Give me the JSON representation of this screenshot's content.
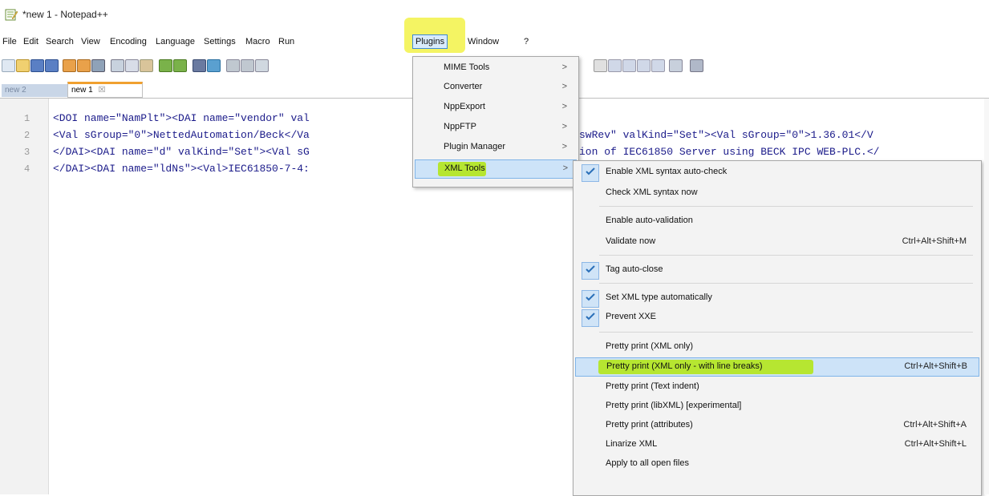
{
  "window": {
    "title": "*new 1 - Notepad++"
  },
  "menubar": {
    "items": [
      "File",
      "Edit",
      "Search",
      "View",
      "Encoding",
      "Language",
      "Settings",
      "Macro",
      "Run",
      "Plugins",
      "Window",
      "?"
    ]
  },
  "tabs": [
    {
      "label": "new 2"
    },
    {
      "label": "new 1"
    }
  ],
  "editor": {
    "lines": [
      {
        "no": "1",
        "text": "<DOI name=\"NamPlt\"><DAI name=\"vendor\" val"
      },
      {
        "no": "2",
        "text": "<Val sGroup=\"0\">NettedAutomation/Beck</Va"
      },
      {
        "no": "3",
        "text": "</DAI><DAI name=\"d\" valKind=\"Set\"><Val sG"
      },
      {
        "no": "4",
        "text": "</DAI><DAI name=\"ldNs\"><Val>IEC61850-7-4:"
      }
    ],
    "right_fragments": [
      "swRev\" valKind=\"Set\"><Val sGroup=\"0\">1.36.01</V",
      "ion of IEC61850 Server using BECK IPC WEB-PLC.</"
    ]
  },
  "plugins_menu": {
    "items": [
      {
        "label": "MIME Tools",
        "arrow": ">"
      },
      {
        "label": "Converter",
        "arrow": ">"
      },
      {
        "label": "NppExport",
        "arrow": ">"
      },
      {
        "label": "NppFTP",
        "arrow": ">"
      },
      {
        "label": "Plugin Manager",
        "arrow": ">"
      },
      {
        "label": "XML Tools",
        "arrow": ">"
      }
    ]
  },
  "xml_tools_menu": {
    "items": [
      {
        "label": "Enable XML syntax auto-check",
        "shortcut": "",
        "checked": true
      },
      {
        "label": "Check XML syntax now",
        "shortcut": "",
        "checked": false
      },
      {
        "label": "Enable auto-validation",
        "shortcut": "",
        "checked": false
      },
      {
        "label": "Validate now",
        "shortcut": "Ctrl+Alt+Shift+M",
        "checked": false
      },
      {
        "label": "Tag auto-close",
        "shortcut": "",
        "checked": true
      },
      {
        "label": "Set XML type automatically",
        "shortcut": "",
        "checked": true
      },
      {
        "label": "Prevent XXE",
        "shortcut": "",
        "checked": true
      },
      {
        "label": "Pretty print (XML only)",
        "shortcut": "",
        "checked": false
      },
      {
        "label": "Pretty print (XML only - with line breaks)",
        "shortcut": "Ctrl+Alt+Shift+B",
        "checked": false
      },
      {
        "label": "Pretty print (Text indent)",
        "shortcut": "",
        "checked": false
      },
      {
        "label": "Pretty print (libXML) [experimental]",
        "shortcut": "",
        "checked": false
      },
      {
        "label": "Pretty print (attributes)",
        "shortcut": "Ctrl+Alt+Shift+A",
        "checked": false
      },
      {
        "label": "Linarize XML",
        "shortcut": "Ctrl+Alt+Shift+L",
        "checked": false
      },
      {
        "label": "Apply to all open files",
        "shortcut": "",
        "checked": false
      }
    ]
  },
  "colors": {
    "highlight_yellow": "#f3f35b",
    "highlight_green": "#b4e61b",
    "menu_selection": "#cde3f8",
    "code_text": "#1b1b8a"
  }
}
